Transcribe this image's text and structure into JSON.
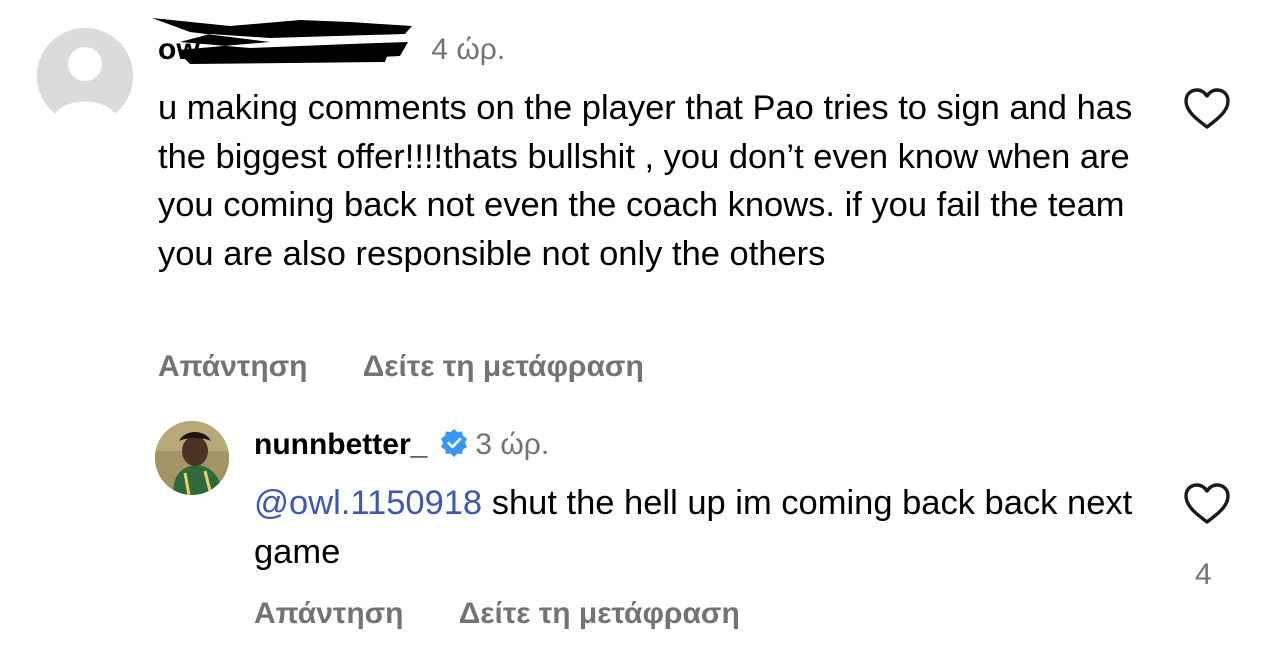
{
  "comment": {
    "username": "ow",
    "time": "4 ώρ.",
    "text": "u making comments on the player that Pao tries to sign and has the biggest offer!!!!thats bullshit , you don’t even know when are you coming back not even the coach knows. if you fail the team you are also responsible not only the others",
    "reply_label": "Απάντηση",
    "translate_label": "Δείτε τη μετάφραση",
    "like_icon": "heart-outline-icon"
  },
  "reply": {
    "username": "nunnbetter_",
    "verified_icon": "verified-badge-icon",
    "time": "3 ώρ.",
    "mention": "@owl.1150918",
    "text": " shut the hell up im coming back back next game",
    "like_icon": "heart-outline-icon",
    "like_count": "4",
    "reply_label": "Απάντηση",
    "translate_label": "Δείτε τη μετάφραση"
  },
  "colors": {
    "text": "#000000",
    "secondary": "#737373",
    "mention": "#3c57b8",
    "verified": "#3897f0",
    "avatar_placeholder": "#dbdbdb"
  }
}
